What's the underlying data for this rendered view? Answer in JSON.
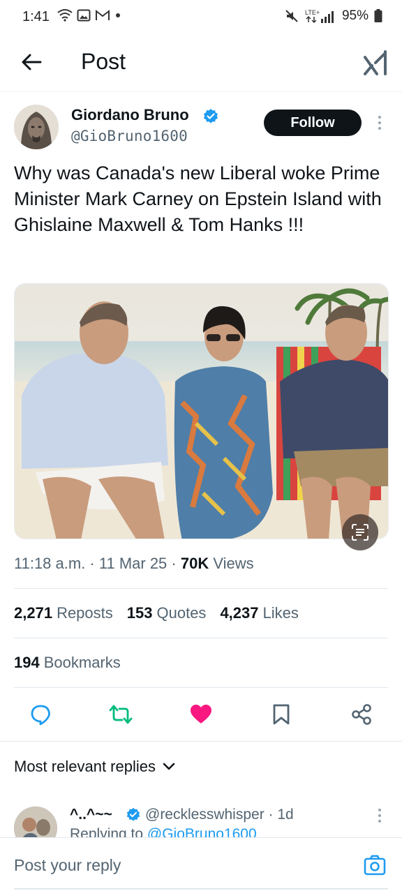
{
  "status_bar": {
    "time": "1:41",
    "network": "LTE+",
    "battery": "95%"
  },
  "header": {
    "title": "Post"
  },
  "post": {
    "author_name": "Giordano Bruno",
    "author_handle": "@GioBruno1600",
    "follow_label": "Follow",
    "text": "Why was Canada's new Liberal woke Prime Minister Mark Carney on Epstein Island with Ghislaine Maxwell & Tom Hanks !!!",
    "timestamp": "11:18 a.m. · 11 Mar 25 · ",
    "views_count": "70K",
    "views_label": " Views"
  },
  "stats": {
    "reposts_count": "2,271",
    "reposts_label": "Reposts",
    "quotes_count": "153",
    "quotes_label": "Quotes",
    "likes_count": "4,237",
    "likes_label": "Likes",
    "bookmarks_count": "194",
    "bookmarks_label": "Bookmarks"
  },
  "replies": {
    "sort_label": "Most relevant replies",
    "items": [
      {
        "name": "^..^~~",
        "handle": "@recklesswhisper · 1d",
        "replying_prefix": "Replying to ",
        "replying_handle": "@GioBruno1600"
      }
    ]
  },
  "composer": {
    "placeholder": "Post your reply"
  },
  "colors": {
    "accent": "#1d9bf0",
    "like": "#f91880",
    "repost": "#00ba7c",
    "text_secondary": "#536471"
  }
}
